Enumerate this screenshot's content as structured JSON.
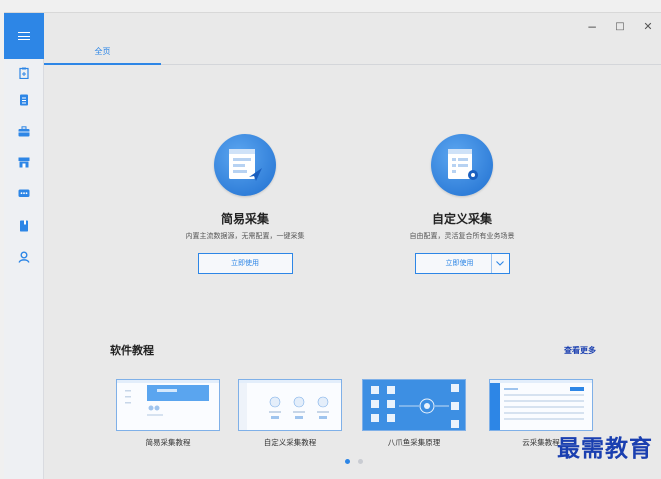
{
  "window": {
    "minimize": "−",
    "maximize": "□",
    "close": "✕"
  },
  "sidebar": {
    "items": [
      {
        "icon": "clipboard-icon"
      },
      {
        "icon": "document-icon"
      },
      {
        "icon": "briefcase-icon"
      },
      {
        "icon": "store-icon"
      },
      {
        "icon": "message-icon"
      },
      {
        "icon": "book-icon"
      },
      {
        "icon": "user-icon"
      }
    ]
  },
  "tabs": [
    {
      "label": "全页"
    }
  ],
  "features": [
    {
      "title": "简易采集",
      "desc": "内置主流数据源，无需配置，一键采集",
      "button": "立即使用"
    },
    {
      "title": "自定义采集",
      "desc": "自由配置，灵活复合所有业务场景",
      "button": "立即使用"
    }
  ],
  "tutorials": {
    "title": "软件教程",
    "more": "查看更多",
    "items": [
      {
        "label": "简易采集教程"
      },
      {
        "label": "自定义采集教程"
      },
      {
        "label": "八爪鱼采集原理"
      },
      {
        "label": "云采集教程"
      }
    ]
  },
  "watermark": "最需教育",
  "colors": {
    "accent": "#2d86e6",
    "link": "#1a3fb0"
  }
}
